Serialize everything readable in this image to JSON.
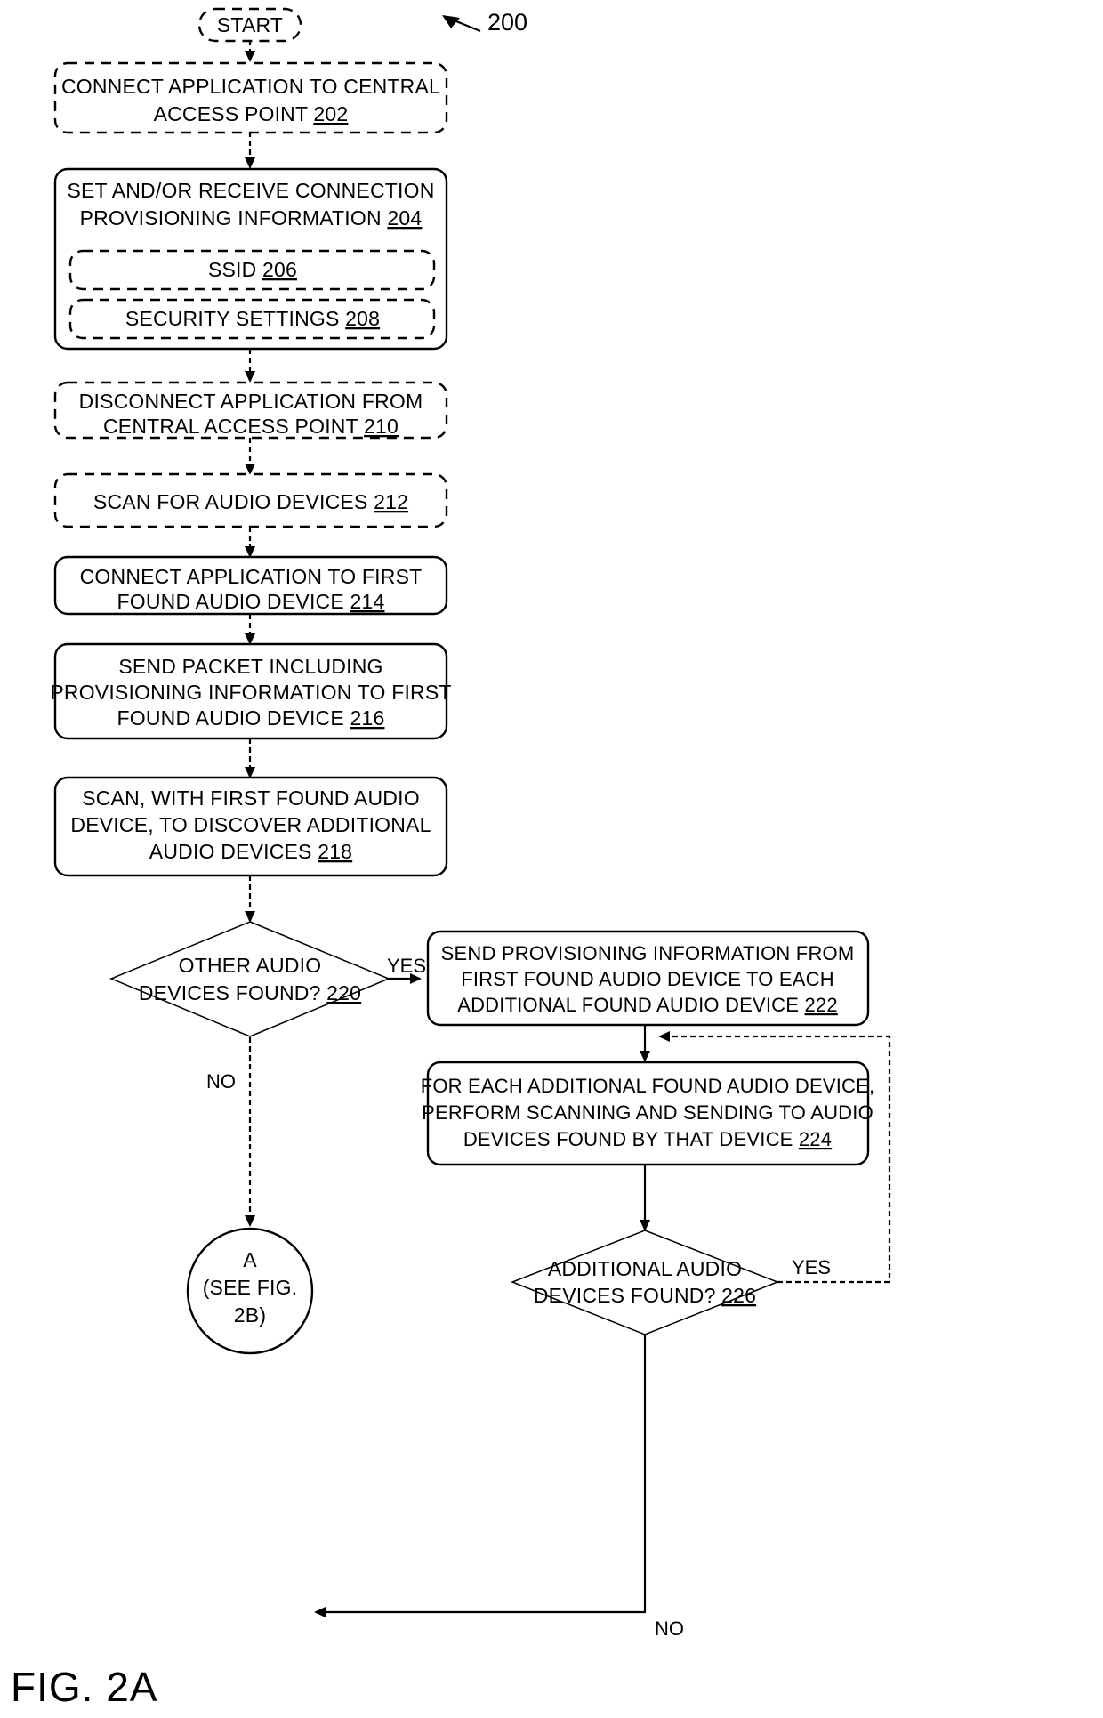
{
  "figure": {
    "caption": "FIG. 2A",
    "reference_numeral": "200"
  },
  "nodes": {
    "start": {
      "label": "START",
      "shape": "stadium-dashed"
    },
    "n202": {
      "line1": "CONNECT APPLICATION TO CENTRAL",
      "line2": "ACCESS POINT",
      "ref": "202",
      "shape": "rounded-dashed"
    },
    "n204": {
      "line1": "SET AND/OR RECEIVE CONNECTION",
      "line2": "PROVISIONING INFORMATION",
      "ref": "204",
      "shape": "rounded-solid"
    },
    "n206": {
      "label": "SSID",
      "ref": "206",
      "shape": "rounded-dashed"
    },
    "n208": {
      "label": "SECURITY SETTINGS",
      "ref": "208",
      "shape": "rounded-dashed"
    },
    "n210": {
      "line1": "DISCONNECT APPLICATION FROM",
      "line2": "CENTRAL ACCESS POINT",
      "ref": "210",
      "shape": "rounded-dashed"
    },
    "n212": {
      "label": "SCAN FOR AUDIO DEVICES",
      "ref": "212",
      "shape": "rounded-dashed"
    },
    "n214": {
      "line1": "CONNECT APPLICATION TO FIRST",
      "line2": "FOUND AUDIO DEVICE",
      "ref": "214",
      "shape": "rounded-solid"
    },
    "n216": {
      "line1": "SEND PACKET INCLUDING",
      "line2": "PROVISIONING INFORMATION TO FIRST",
      "line3": "FOUND AUDIO DEVICE",
      "ref": "216",
      "shape": "rounded-solid"
    },
    "n218": {
      "line1": "SCAN, WITH FIRST FOUND AUDIO",
      "line2": "DEVICE, TO DISCOVER ADDITIONAL",
      "line3": "AUDIO DEVICES",
      "ref": "218",
      "shape": "rounded-solid"
    },
    "n220": {
      "line1": "OTHER AUDIO",
      "line2": "DEVICES FOUND?",
      "ref": "220",
      "shape": "diamond"
    },
    "n222": {
      "line1": "SEND PROVISIONING INFORMATION FROM",
      "line2": "FIRST FOUND AUDIO DEVICE TO EACH",
      "line3": "ADDITIONAL FOUND AUDIO DEVICE",
      "ref": "222",
      "shape": "rounded-solid"
    },
    "n224": {
      "line1": "FOR EACH ADDITIONAL FOUND AUDIO DEVICE,",
      "line2": "PERFORM SCANNING AND SENDING TO AUDIO",
      "line3": "DEVICES FOUND BY THAT DEVICE",
      "ref": "224",
      "shape": "rounded-solid"
    },
    "n226": {
      "line1": "ADDITIONAL AUDIO",
      "line2": "DEVICES FOUND?",
      "ref": "226",
      "shape": "diamond"
    },
    "connector_a": {
      "line1": "A",
      "line2": "(SEE FIG.",
      "line3": "2B)",
      "shape": "circle"
    }
  },
  "edge_labels": {
    "yes_220": "YES",
    "no_220": "NO",
    "yes_226": "YES",
    "no_226": "NO"
  },
  "colors": {
    "stroke": "#000000",
    "fill": "#ffffff"
  }
}
